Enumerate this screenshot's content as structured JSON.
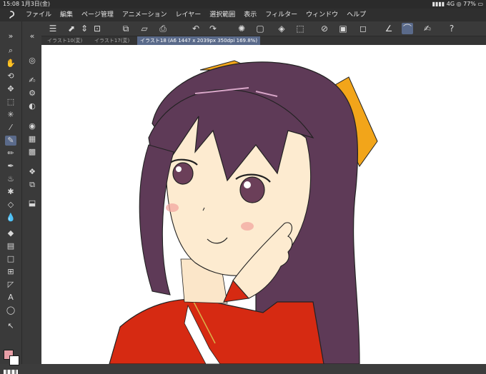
{
  "status": {
    "time": "15:08",
    "date": "1月3日(金)",
    "network": "4G",
    "battery": "77%"
  },
  "menu": {
    "items": [
      "ファイル",
      "編集",
      "ページ管理",
      "アニメーション",
      "レイヤー",
      "選択範囲",
      "表示",
      "フィルター",
      "ウィンドウ",
      "ヘルプ"
    ]
  },
  "tabs": [
    {
      "label": "イラスト10(変)"
    },
    {
      "label": "イラスト17(変)"
    },
    {
      "label": "イラスト18 (A6 1447 x 2039px 350dpi 169.8%)"
    }
  ],
  "toolbar": {
    "icons": [
      "menu-icon",
      "new-icon",
      "spin-icon",
      "fit-icon",
      "copy-icon",
      "open-icon",
      "save-icon",
      "undo-icon",
      "redo-icon",
      "loading-icon",
      "fill-icon",
      "transform-icon",
      "grid-icon",
      "guide-icon",
      "frame-icon",
      "ruler-icon",
      "smooth-icon",
      "pen-icon",
      "help-icon"
    ]
  },
  "colors": {
    "primary": "#e79ea6",
    "secondary": "#ffffff",
    "accent": "#5a6a8a"
  }
}
